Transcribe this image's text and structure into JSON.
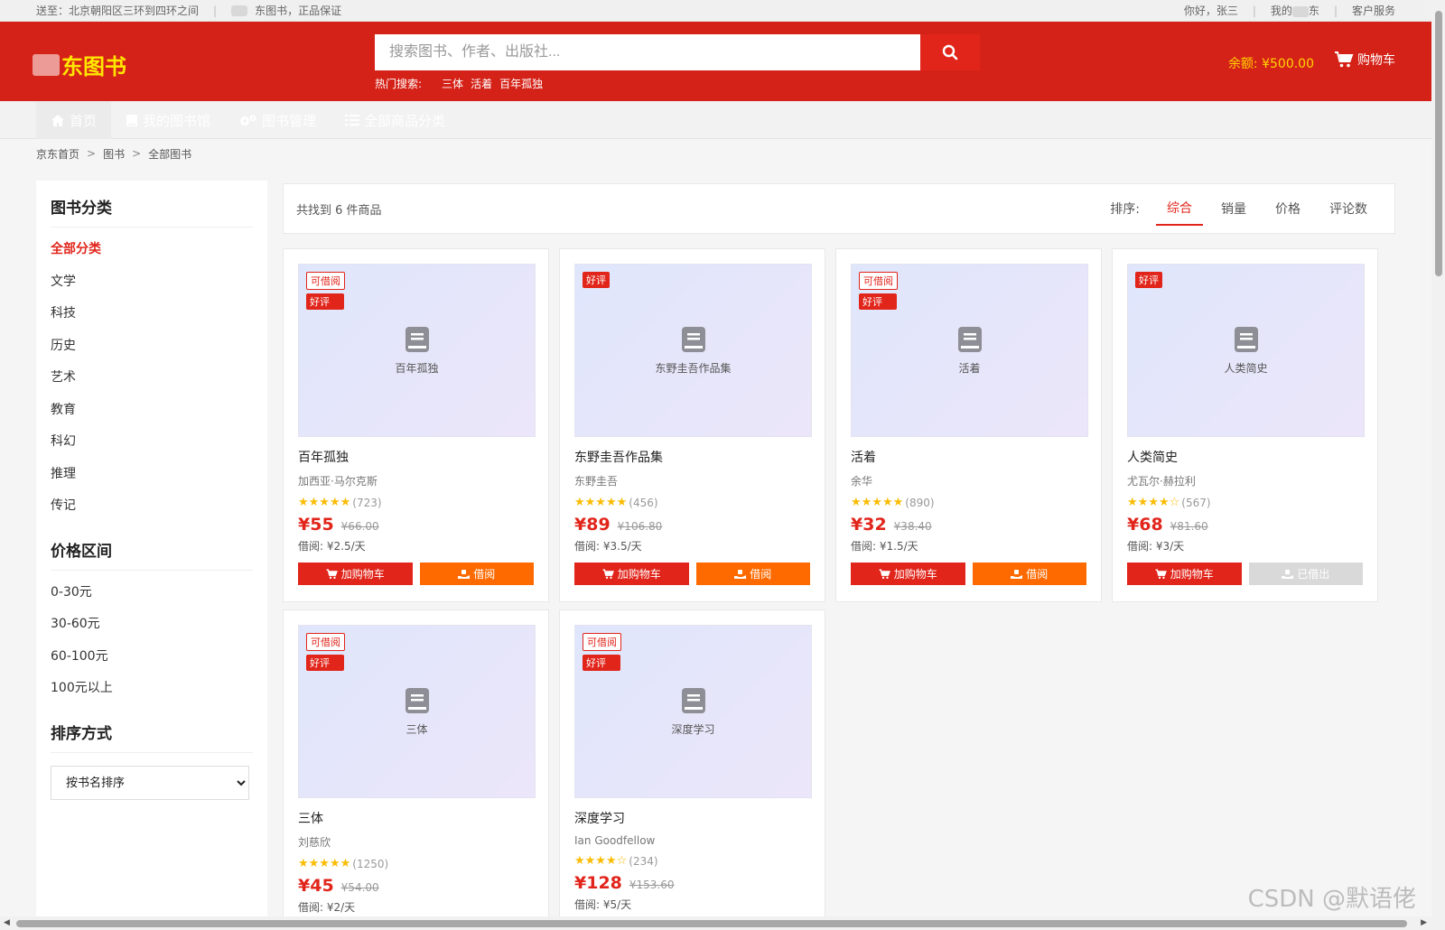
{
  "topbar": {
    "delivery": "送至：北京朝阳区三环到四环之间",
    "slogan": "东图书，正品保证",
    "greeting": "你好，张三",
    "my_prefix": "我的",
    "my_suffix": "东",
    "service": "客户服务"
  },
  "header": {
    "logo_text": "东图书",
    "search_placeholder": "搜索图书、作者、出版社...",
    "hot_label": "热门搜索:",
    "hot_terms": [
      "三体",
      "活着",
      "百年孤独"
    ],
    "balance": "余额: ¥500.00",
    "cart": "购物车"
  },
  "nav": {
    "items": [
      {
        "label": "首页",
        "icon": "home-icon"
      },
      {
        "label": "我的图书馆",
        "icon": "book-icon"
      },
      {
        "label": "图书管理",
        "icon": "gears-icon"
      },
      {
        "label": "全部商品分类",
        "icon": "list-icon"
      }
    ]
  },
  "breadcrumb": [
    "京东首页",
    "图书",
    "全部图书"
  ],
  "sidebar": {
    "category_title": "图书分类",
    "categories": [
      "全部分类",
      "文学",
      "科技",
      "历史",
      "艺术",
      "教育",
      "科幻",
      "推理",
      "传记"
    ],
    "price_title": "价格区间",
    "prices": [
      "0-30元",
      "30-60元",
      "60-100元",
      "100元以上"
    ],
    "sort_title": "排序方式",
    "sort_select": "按书名排序"
  },
  "toolbar": {
    "count": "共找到 6 件商品",
    "sort_label": "排序:",
    "sort_options": [
      "综合",
      "销量",
      "价格",
      "评论数"
    ]
  },
  "labels": {
    "badge_borrow": "可借阅",
    "badge_good": "好评",
    "add_cart": "加购物车",
    "borrow": "借阅",
    "borrowed": "已借出"
  },
  "books": [
    {
      "title": "百年孤独",
      "author": "加西亚·马尔克斯",
      "stars": "★★★★★",
      "reviews": "(723)",
      "price": "¥55",
      "orig": "¥66.00",
      "rent": "借阅: ¥2.5/天"
    },
    {
      "title": "东野圭吾作品集",
      "author": "东野圭吾",
      "stars": "★★★★★",
      "reviews": "(456)",
      "price": "¥89",
      "orig": "¥106.80",
      "rent": "借阅: ¥3.5/天"
    },
    {
      "title": "活着",
      "author": "余华",
      "stars": "★★★★★",
      "reviews": "(890)",
      "price": "¥32",
      "orig": "¥38.40",
      "rent": "借阅: ¥1.5/天"
    },
    {
      "title": "人类简史",
      "author": "尤瓦尔·赫拉利",
      "stars": "★★★★☆",
      "reviews": "(567)",
      "price": "¥68",
      "orig": "¥81.60",
      "rent": "借阅: ¥3/天"
    },
    {
      "title": "三体",
      "author": "刘慈欣",
      "stars": "★★★★★",
      "reviews": "(1250)",
      "price": "¥45",
      "orig": "¥54.00",
      "rent": "借阅: ¥2/天"
    },
    {
      "title": "深度学习",
      "author": "Ian Goodfellow",
      "stars": "★★★★☆",
      "reviews": "(234)",
      "price": "¥128",
      "orig": "¥153.60",
      "rent": "借阅: ¥5/天"
    }
  ],
  "watermark": "CSDN @默语佬"
}
